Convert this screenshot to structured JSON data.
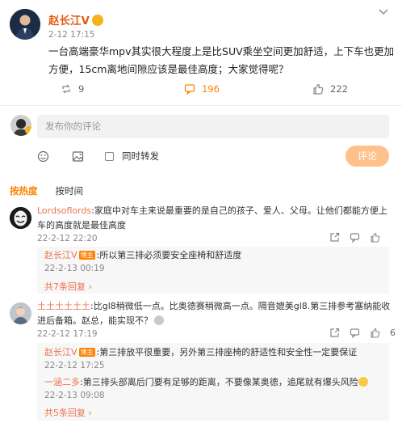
{
  "post": {
    "username": "赵长江V",
    "date": "2-12 17:15",
    "text": "一台高端豪华mpv其实很大程度上是比SUV乘坐空间更加舒适，上下车也更加方便，15cm离地间隙应该是最佳高度；大家觉得呢？",
    "repost_count": "9",
    "comment_count": "196",
    "like_count": "222"
  },
  "composer": {
    "placeholder": "发布你的评论",
    "forward_label": "同时转发",
    "submit_label": "评论"
  },
  "tabs": {
    "hot": "按热度",
    "time": "按时间"
  },
  "comments": [
    {
      "name": "Lordsoflords",
      "text": ":家庭中对车主来说最重要的是自己的孩子、爱人、父母。让他们都能方便上车的高度就是最佳高度",
      "date": "22-2-12 22:20",
      "likes": "",
      "replies": [
        {
          "name": "赵长江V",
          "tag": "博主",
          "text": ":所以第三排必须要安全座椅和舒适度",
          "date": "22-2-13 00:19"
        }
      ],
      "more": "共7条回复 ›"
    },
    {
      "name": "土土土土土土",
      "text": ":比gl8稍微低一点。比奥德赛稍微高一点。隔音媲美gl8.第三排参考塞纳能收进后备箱。赵总，能实现不？",
      "date": "22-2-12 17:19",
      "likes": "6",
      "replies": [
        {
          "name": "赵长江V",
          "tag": "博主",
          "text": ":第三排放平很重要，另外第三排座椅的舒适性和安全性一定要保证",
          "date": "22-2-12 17:25"
        },
        {
          "name": "一涵二多",
          "tag": "",
          "text": ":第三排头部离后门要有足够的距离，不要像某奥德，追尾就有爆头风险",
          "date": "22-2-13 09:08"
        }
      ],
      "more": "共5条回复 ›"
    }
  ],
  "colors": {
    "accent": "#ff8200",
    "name": "#eb7350",
    "username": "#e05b13"
  }
}
